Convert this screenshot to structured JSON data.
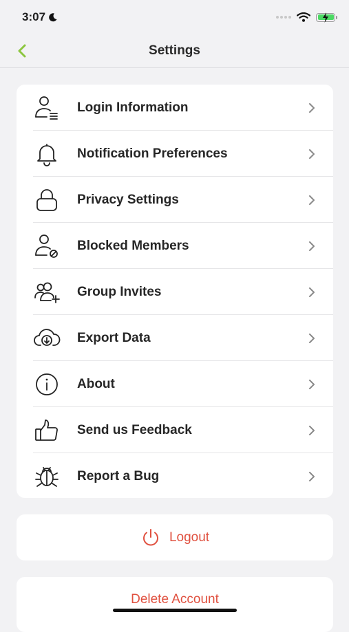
{
  "status_bar": {
    "time": "3:07",
    "battery_color": "#4cd964"
  },
  "nav": {
    "title": "Settings",
    "back_icon": "chevron-left-icon",
    "accent_color": "#8cc63f"
  },
  "menu": {
    "items": [
      {
        "label": "Login Information",
        "icon": "user-lines-icon"
      },
      {
        "label": "Notification Preferences",
        "icon": "bell-icon"
      },
      {
        "label": "Privacy Settings",
        "icon": "lock-icon"
      },
      {
        "label": "Blocked Members",
        "icon": "user-blocked-icon"
      },
      {
        "label": "Group Invites",
        "icon": "group-add-icon"
      },
      {
        "label": "Export Data",
        "icon": "cloud-download-icon"
      },
      {
        "label": "About",
        "icon": "info-icon"
      },
      {
        "label": "Send us Feedback",
        "icon": "thumbs-up-icon"
      },
      {
        "label": "Report a Bug",
        "icon": "bug-icon"
      }
    ]
  },
  "actions": {
    "logout_label": "Logout",
    "delete_label": "Delete Account",
    "danger_color": "#e0503f"
  }
}
